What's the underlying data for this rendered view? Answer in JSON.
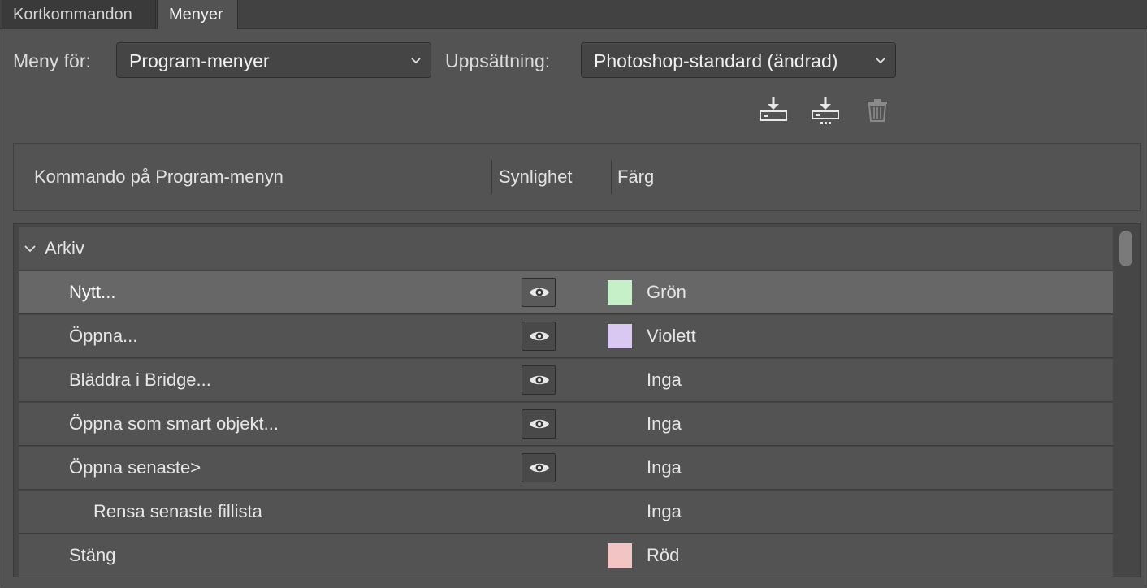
{
  "tabs": [
    {
      "label": "Kortkommandon",
      "active": false
    },
    {
      "label": "Menyer",
      "active": true
    }
  ],
  "toolbar": {
    "menu_for_label": "Meny för:",
    "menu_for_value": "Program-menyer",
    "set_label": "Uppsättning:",
    "set_value": "Photoshop-standard (ändrad)"
  },
  "icons": {
    "save": "save-set-icon",
    "save_as": "save-set-as-icon",
    "delete": "trash-icon",
    "eye": "eye-icon",
    "chevron": "chevron-down-icon"
  },
  "table": {
    "headers": {
      "command": "Kommando på Program-menyn",
      "visibility": "Synlighet",
      "color": "Färg"
    },
    "group": {
      "label": "Arkiv",
      "expanded": true
    },
    "rows": [
      {
        "name": "Nytt...",
        "visible": true,
        "color": "Grön",
        "swatch": "#c6f0c8",
        "selected": true
      },
      {
        "name": "Öppna...",
        "visible": true,
        "color": "Violett",
        "swatch": "#d9c8f2",
        "selected": false
      },
      {
        "name": "Bläddra i Bridge...",
        "visible": true,
        "color": "Inga",
        "swatch": null,
        "selected": false
      },
      {
        "name": "Öppna som smart objekt...",
        "visible": true,
        "color": "Inga",
        "swatch": null,
        "selected": false
      },
      {
        "name": "Öppna senaste>",
        "visible": true,
        "color": "Inga",
        "swatch": null,
        "selected": false
      },
      {
        "name": "Rensa senaste fillista",
        "visible": false,
        "color": "Inga",
        "swatch": null,
        "selected": false,
        "indent": 2
      },
      {
        "name": "Stäng",
        "visible": false,
        "color": "Röd",
        "swatch": "#f2c4c4",
        "selected": false
      }
    ]
  },
  "colors": {
    "background": "#535353",
    "selected_row": "#676767"
  }
}
